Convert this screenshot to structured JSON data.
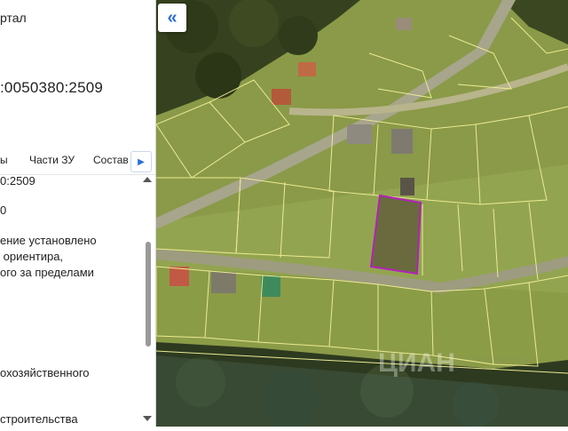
{
  "sidebar": {
    "portal_label": "ртал",
    "cadastral_number": ":0050380:2509",
    "tabs": [
      "ы",
      "Части ЗУ",
      "Состав"
    ],
    "next_tab_icon": "chevron-right-icon",
    "values": {
      "number": "0:2509",
      "digit": "0",
      "location": "ение установлено\n ориентира,\nого за пределами",
      "category": "охозяйственного",
      "use": "строительства"
    }
  },
  "map": {
    "collapse_icon": "double-chevron-left-icon",
    "selected_color": "#b321b8",
    "boundary_color": "#e9e48a",
    "watermark": "ЦИАН"
  }
}
